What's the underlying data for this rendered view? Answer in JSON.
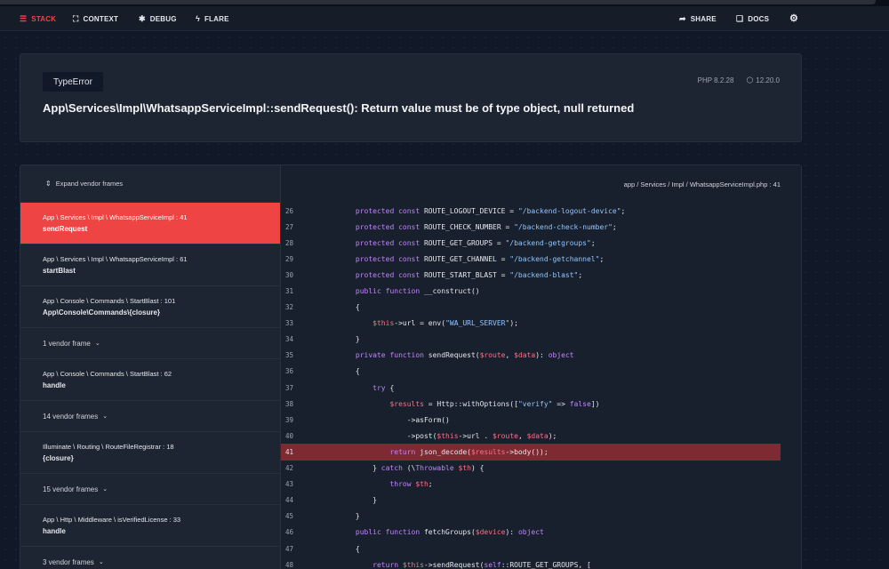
{
  "nav": {
    "stack": "STACK",
    "context": "CONTEXT",
    "debug": "DEBUG",
    "flare": "FLARE",
    "share": "SHARE",
    "docs": "DOCS"
  },
  "error": {
    "type": "TypeError",
    "message": "App\\Services\\Impl\\WhatsappServiceImpl::sendRequest(): Return value must be of type object, null returned",
    "php_version": "PHP 8.2.28",
    "laravel_version": "12.20.0"
  },
  "frames_panel": {
    "expand_label": "Expand vendor frames",
    "frames": [
      {
        "kind": "app",
        "path": "App \\ Services \\ Impl \\ WhatsappServiceImpl : 41",
        "fn": "sendRequest",
        "active": true
      },
      {
        "kind": "app",
        "path": "App \\ Services \\ Impl \\ WhatsappServiceImpl : 61",
        "fn": "startBlast"
      },
      {
        "kind": "app",
        "path": "App \\ Console \\ Commands \\ StartBlast : 101",
        "fn": "App\\Console\\Commands\\{closure}"
      },
      {
        "kind": "vendor",
        "label": "1 vendor frame"
      },
      {
        "kind": "app",
        "path": "App \\ Console \\ Commands \\ StartBlast : 62",
        "fn": "handle"
      },
      {
        "kind": "vendor",
        "label": "14 vendor frames"
      },
      {
        "kind": "app",
        "path": "Illuminate \\ Routing \\ RouteFileRegistrar : 18",
        "fn": "{closure}"
      },
      {
        "kind": "vendor",
        "label": "15 vendor frames"
      },
      {
        "kind": "app",
        "path": "App \\ Http \\ Middleware \\ isVerifiedLicense : 33",
        "fn": "handle"
      },
      {
        "kind": "vendor",
        "label": "3 vendor frames"
      }
    ]
  },
  "code": {
    "file_path": "app / Services / Impl / WhatsappServiceImpl.php : 41",
    "highlight_line": 41,
    "lines": [
      {
        "n": "26",
        "t": [
          [
            "      ",
            ""
          ],
          [
            "protected const ",
            "kw"
          ],
          [
            "ROUTE_LOGOUT_DEVICE = ",
            "tx"
          ],
          [
            "\"/backend-logout-device\"",
            "st"
          ],
          [
            ";",
            "tx"
          ]
        ]
      },
      {
        "n": "27",
        "t": [
          [
            "      ",
            ""
          ],
          [
            "protected const ",
            "kw"
          ],
          [
            "ROUTE_CHECK_NUMBER = ",
            "tx"
          ],
          [
            "\"/backend-check-number\"",
            "st"
          ],
          [
            ";",
            "tx"
          ]
        ]
      },
      {
        "n": "28",
        "t": [
          [
            "      ",
            ""
          ],
          [
            "protected const ",
            "kw"
          ],
          [
            "ROUTE_GET_GROUPS = ",
            "tx"
          ],
          [
            "\"/backend-getgroups\"",
            "st"
          ],
          [
            ";",
            "tx"
          ]
        ]
      },
      {
        "n": "29",
        "t": [
          [
            "      ",
            ""
          ],
          [
            "protected const ",
            "kw"
          ],
          [
            "ROUTE_GET_CHANNEL = ",
            "tx"
          ],
          [
            "\"/backend-getchannel\"",
            "st"
          ],
          [
            ";",
            "tx"
          ]
        ]
      },
      {
        "n": "30",
        "t": [
          [
            "      ",
            ""
          ],
          [
            "protected const ",
            "kw"
          ],
          [
            "ROUTE_START_BLAST = ",
            "tx"
          ],
          [
            "\"/backend-blast\"",
            "st"
          ],
          [
            ";",
            "tx"
          ]
        ]
      },
      {
        "n": "31",
        "t": [
          [
            "      ",
            ""
          ],
          [
            "public function ",
            "kw"
          ],
          [
            "__construct()",
            "fnc"
          ]
        ]
      },
      {
        "n": "32",
        "t": [
          [
            "      {",
            "tx"
          ]
        ]
      },
      {
        "n": "33",
        "t": [
          [
            "          ",
            ""
          ],
          [
            "$this",
            "vr"
          ],
          [
            "->url = env(",
            "tx"
          ],
          [
            "\"WA_URL_SERVER\"",
            "st"
          ],
          [
            ");",
            "tx"
          ]
        ]
      },
      {
        "n": "34",
        "t": [
          [
            "      }",
            "tx"
          ]
        ]
      },
      {
        "n": "35",
        "t": [
          [
            "      ",
            ""
          ],
          [
            "private function ",
            "kw"
          ],
          [
            "sendRequest(",
            "fnc"
          ],
          [
            "$route",
            "vr"
          ],
          [
            ", ",
            "tx"
          ],
          [
            "$data",
            "vr"
          ],
          [
            "): ",
            "tx"
          ],
          [
            "object",
            "kw"
          ]
        ]
      },
      {
        "n": "36",
        "t": [
          [
            "      {",
            "tx"
          ]
        ]
      },
      {
        "n": "37",
        "t": [
          [
            "          ",
            ""
          ],
          [
            "try ",
            "kw"
          ],
          [
            "{",
            "tx"
          ]
        ]
      },
      {
        "n": "38",
        "t": [
          [
            "              ",
            ""
          ],
          [
            "$results",
            "vr"
          ],
          [
            " = Http::withOptions([",
            "tx"
          ],
          [
            "\"verify\"",
            "st"
          ],
          [
            " => ",
            "tx"
          ],
          [
            "false",
            "kw"
          ],
          [
            "])",
            "tx"
          ]
        ]
      },
      {
        "n": "39",
        "t": [
          [
            "                  ->asForm()",
            "tx"
          ]
        ]
      },
      {
        "n": "40",
        "t": [
          [
            "                  ->post(",
            "tx"
          ],
          [
            "$this",
            "vr"
          ],
          [
            "->url . ",
            "tx"
          ],
          [
            "$route",
            "vr"
          ],
          [
            ", ",
            "tx"
          ],
          [
            "$data",
            "vr"
          ],
          [
            ");",
            "tx"
          ]
        ]
      },
      {
        "n": "41",
        "t": [
          [
            "              ",
            ""
          ],
          [
            "return ",
            "kw"
          ],
          [
            "json_decode(",
            "tx"
          ],
          [
            "$results",
            "vr"
          ],
          [
            "->body());",
            "tx"
          ]
        ]
      },
      {
        "n": "42",
        "t": [
          [
            "          } ",
            "tx"
          ],
          [
            "catch ",
            "kw"
          ],
          [
            "(\\",
            "tx"
          ],
          [
            "Throwable ",
            "kw"
          ],
          [
            "$th",
            "vr"
          ],
          [
            ") {",
            "tx"
          ]
        ]
      },
      {
        "n": "43",
        "t": [
          [
            "              ",
            ""
          ],
          [
            "throw ",
            "kw"
          ],
          [
            "$th",
            "vr"
          ],
          [
            ";",
            "tx"
          ]
        ]
      },
      {
        "n": "44",
        "t": [
          [
            "          }",
            "tx"
          ]
        ]
      },
      {
        "n": "45",
        "t": [
          [
            "      }",
            "tx"
          ]
        ]
      },
      {
        "n": "46",
        "t": [
          [
            "      ",
            ""
          ],
          [
            "public function ",
            "kw"
          ],
          [
            "fetchGroups(",
            "fnc"
          ],
          [
            "$device",
            "vr"
          ],
          [
            "): ",
            "tx"
          ],
          [
            "object",
            "kw"
          ]
        ]
      },
      {
        "n": "47",
        "t": [
          [
            "      {",
            "tx"
          ]
        ]
      },
      {
        "n": "48",
        "t": [
          [
            "          ",
            ""
          ],
          [
            "return ",
            "kw"
          ],
          [
            "$this",
            "vr"
          ],
          [
            "->sendRequest(",
            "tx"
          ],
          [
            "self",
            "kw"
          ],
          [
            "::ROUTE_GET_GROUPS, [",
            "tx"
          ]
        ]
      }
    ]
  }
}
